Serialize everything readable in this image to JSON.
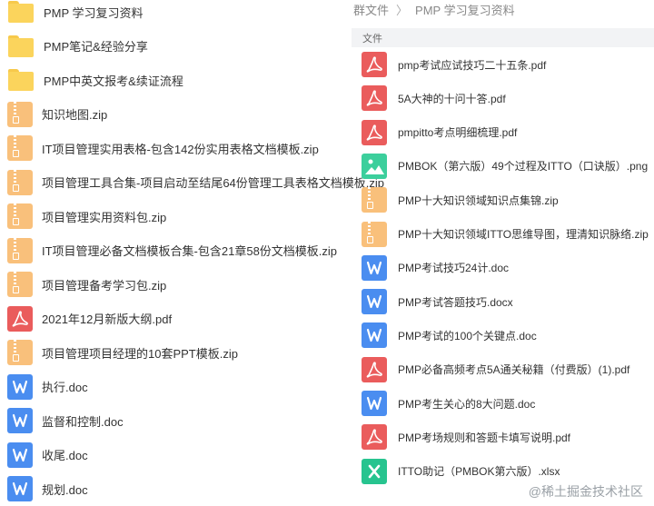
{
  "left_items": [
    {
      "name": "PMP 学习复习资料",
      "type": "folder"
    },
    {
      "name": "PMP笔记&经验分享",
      "type": "folder"
    },
    {
      "name": "PMP中英文报考&续证流程",
      "type": "folder"
    },
    {
      "name": "知识地图.zip",
      "type": "zip"
    },
    {
      "name": "IT项目管理实用表格-包含142份实用表格文档模板.zip",
      "type": "zip"
    },
    {
      "name": "项目管理工具合集-项目启动至结尾64份管理工具表格文档模板.zip",
      "type": "zip"
    },
    {
      "name": "项目管理实用资料包.zip",
      "type": "zip"
    },
    {
      "name": "IT项目管理必备文档模板合集-包含21章58份文档模板.zip",
      "type": "zip"
    },
    {
      "name": "项目管理备考学习包.zip",
      "type": "zip"
    },
    {
      "name": "2021年12月新版大纲.pdf",
      "type": "pdf"
    },
    {
      "name": "项目管理项目经理的10套PPT模板.zip",
      "type": "zip"
    },
    {
      "name": "执行.doc",
      "type": "doc"
    },
    {
      "name": "监督和控制.doc",
      "type": "doc"
    },
    {
      "name": "收尾.doc",
      "type": "doc"
    },
    {
      "name": "规划.doc",
      "type": "doc"
    }
  ],
  "breadcrumb": {
    "root": "群文件",
    "separator": "〉",
    "current": "PMP 学习复习资料"
  },
  "column_header": "文件",
  "right_items": [
    {
      "name": "pmp考试应试技巧二十五条.pdf",
      "type": "pdf"
    },
    {
      "name": "5A大神的十问十答.pdf",
      "type": "pdf"
    },
    {
      "name": "pmpitto考点明细梳理.pdf",
      "type": "pdf"
    },
    {
      "name": "PMBOK（第六版）49个过程及ITTO（口诀版）.png",
      "type": "png"
    },
    {
      "name": "PMP十大知识领域知识点集锦.zip",
      "type": "zip"
    },
    {
      "name": "PMP十大知识领域ITTO思维导图，理清知识脉络.zip",
      "type": "zip"
    },
    {
      "name": "PMP考试技巧24计.doc",
      "type": "doc"
    },
    {
      "name": "PMP考试答题技巧.docx",
      "type": "doc"
    },
    {
      "name": "PMP考试的100个关键点.doc",
      "type": "doc"
    },
    {
      "name": "PMP必备高频考点5A通关秘籍（付费版）(1).pdf",
      "type": "pdf"
    },
    {
      "name": "PMP考生关心的8大问题.doc",
      "type": "doc"
    },
    {
      "name": "PMP考场规则和答题卡填写说明.pdf",
      "type": "pdf"
    },
    {
      "name": "ITTO助记（PMBOK第六版）.xlsx",
      "type": "xls"
    }
  ],
  "watermark": "@稀土掘金技术社区",
  "icon_names": {
    "folder": "folder-icon",
    "zip": "zip-file-icon",
    "pdf": "pdf-file-icon",
    "doc": "word-file-icon",
    "png": "image-file-icon",
    "xls": "excel-file-icon"
  }
}
